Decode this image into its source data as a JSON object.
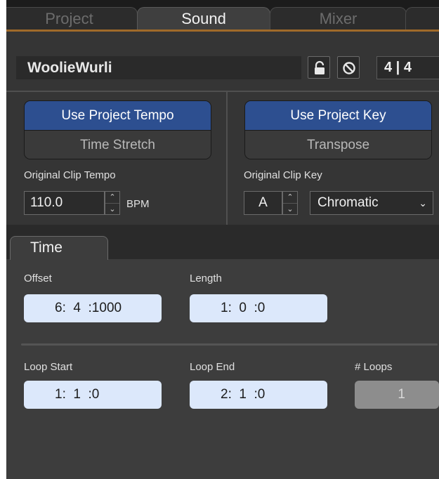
{
  "tabs": [
    {
      "label": "Project",
      "active": false
    },
    {
      "label": "Sound",
      "active": true
    },
    {
      "label": "Mixer",
      "active": false
    }
  ],
  "clip": {
    "name": "WoolieWurli",
    "time_signature": "4 | 4",
    "lock_icon": "lock-icon",
    "disable_icon": "disable-icon"
  },
  "tempo": {
    "use_project_label": "Use Project Tempo",
    "mode_label": "Time Stretch",
    "original_label": "Original Clip Tempo",
    "value": "110.0",
    "unit": "BPM"
  },
  "key": {
    "use_project_label": "Use Project Key",
    "mode_label": "Transpose",
    "original_label": "Original Clip Key",
    "value": "A",
    "scale": "Chromatic"
  },
  "time_panel": {
    "tab_label": "Time",
    "offset_label": "Offset",
    "offset_value": "6:  4  :1000",
    "length_label": "Length",
    "length_value": "1:  0  :0",
    "loop_start_label": "Loop Start",
    "loop_start_value": "1:  1  :0",
    "loop_end_label": "Loop End",
    "loop_end_value": "2:  1  :0",
    "loops_label": "# Loops",
    "loops_value": "1"
  },
  "colors": {
    "accent_blue": "#2d4f90",
    "accent_orange": "#a06a2a",
    "value_field": "#dce8fb"
  }
}
